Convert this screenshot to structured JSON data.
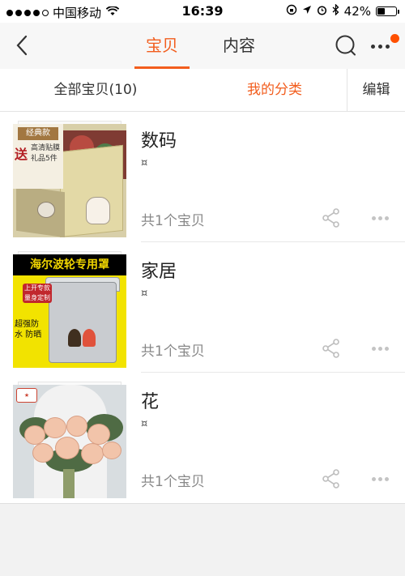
{
  "status_bar": {
    "carrier": "中国移动",
    "time": "16:39",
    "battery_percent": "42%",
    "battery_level": 0.42
  },
  "nav": {
    "tabs": [
      {
        "label": "宝贝",
        "active": true
      },
      {
        "label": "内容",
        "active": false
      }
    ],
    "icons": [
      "back-chevron-icon",
      "search-icon",
      "more-icon"
    ],
    "accent_color": "#f25d1d",
    "badge_color": "#ff5000"
  },
  "sub_tabs": {
    "all_label": "全部宝贝(10)",
    "category_label": "我的分类",
    "edit_label": "编辑"
  },
  "categories": [
    {
      "name": "数码",
      "glyph": "¤",
      "count": "共1个宝贝"
    },
    {
      "name": "家居",
      "glyph": "¤",
      "count": "共1个宝贝"
    },
    {
      "name": "花",
      "glyph": "¤",
      "count": "共1个宝贝"
    }
  ],
  "thumbnails": {
    "digital": {
      "badge": "经典款",
      "send": "送",
      "gift": "高清贴膜 礼品5件"
    },
    "home": {
      "title": "海尔波轮专用罩",
      "tag": "上开专款 量身定制",
      "feature": "超强防水 防晒"
    }
  }
}
